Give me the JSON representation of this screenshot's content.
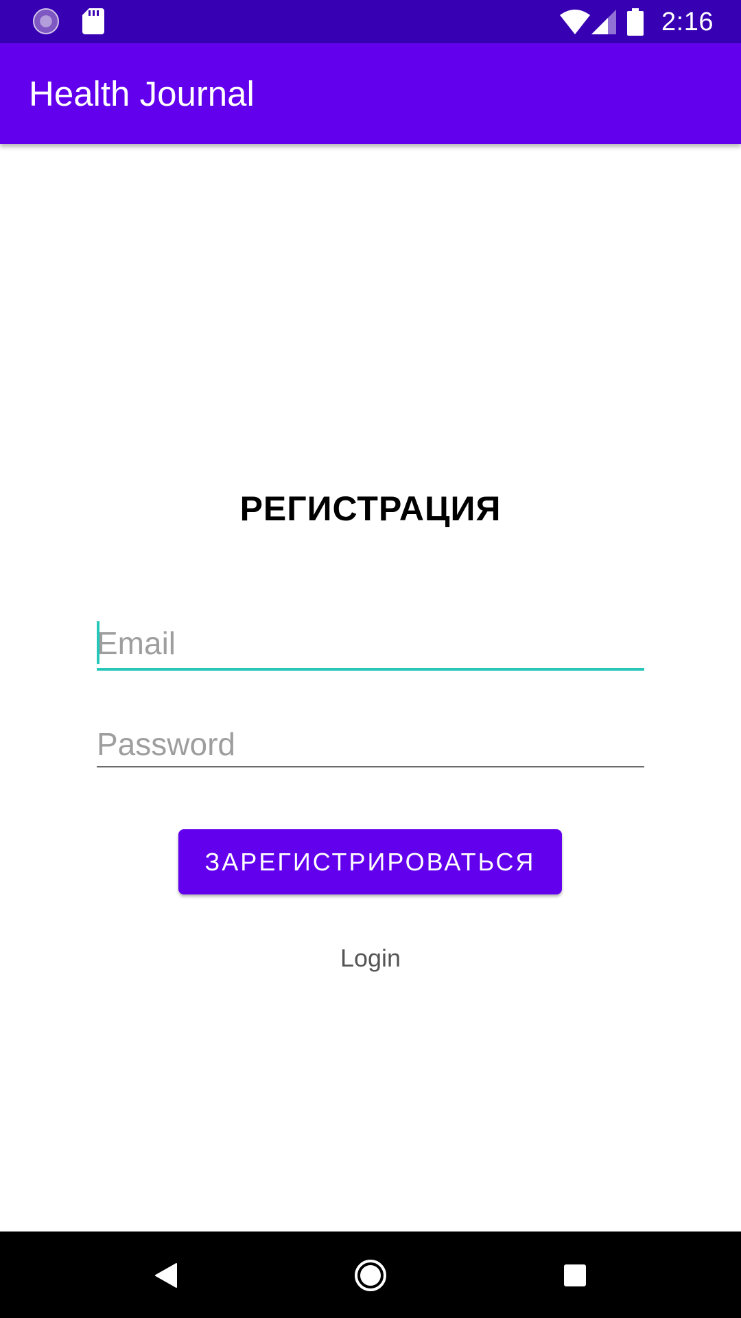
{
  "status_bar": {
    "time": "2:16",
    "icons": [
      "sync-icon",
      "sd-card-icon",
      "wifi-icon",
      "signal-icon",
      "battery-icon"
    ]
  },
  "app_bar": {
    "title": "Health Journal"
  },
  "form": {
    "heading": "РЕГИСТРАЦИЯ",
    "email": {
      "value": "",
      "placeholder": "Email"
    },
    "password": {
      "value": "",
      "placeholder": "Password"
    },
    "register_button_label": "ЗАРЕГИСТРИРОВАТЬСЯ",
    "login_link": "Login"
  },
  "nav_bar": {
    "icons": [
      "back-icon",
      "home-icon",
      "recents-icon"
    ]
  },
  "colors": {
    "status_bar": "#3700b3",
    "primary": "#6200ee",
    "accent": "#26c6b9",
    "nav_bar": "#000000"
  }
}
